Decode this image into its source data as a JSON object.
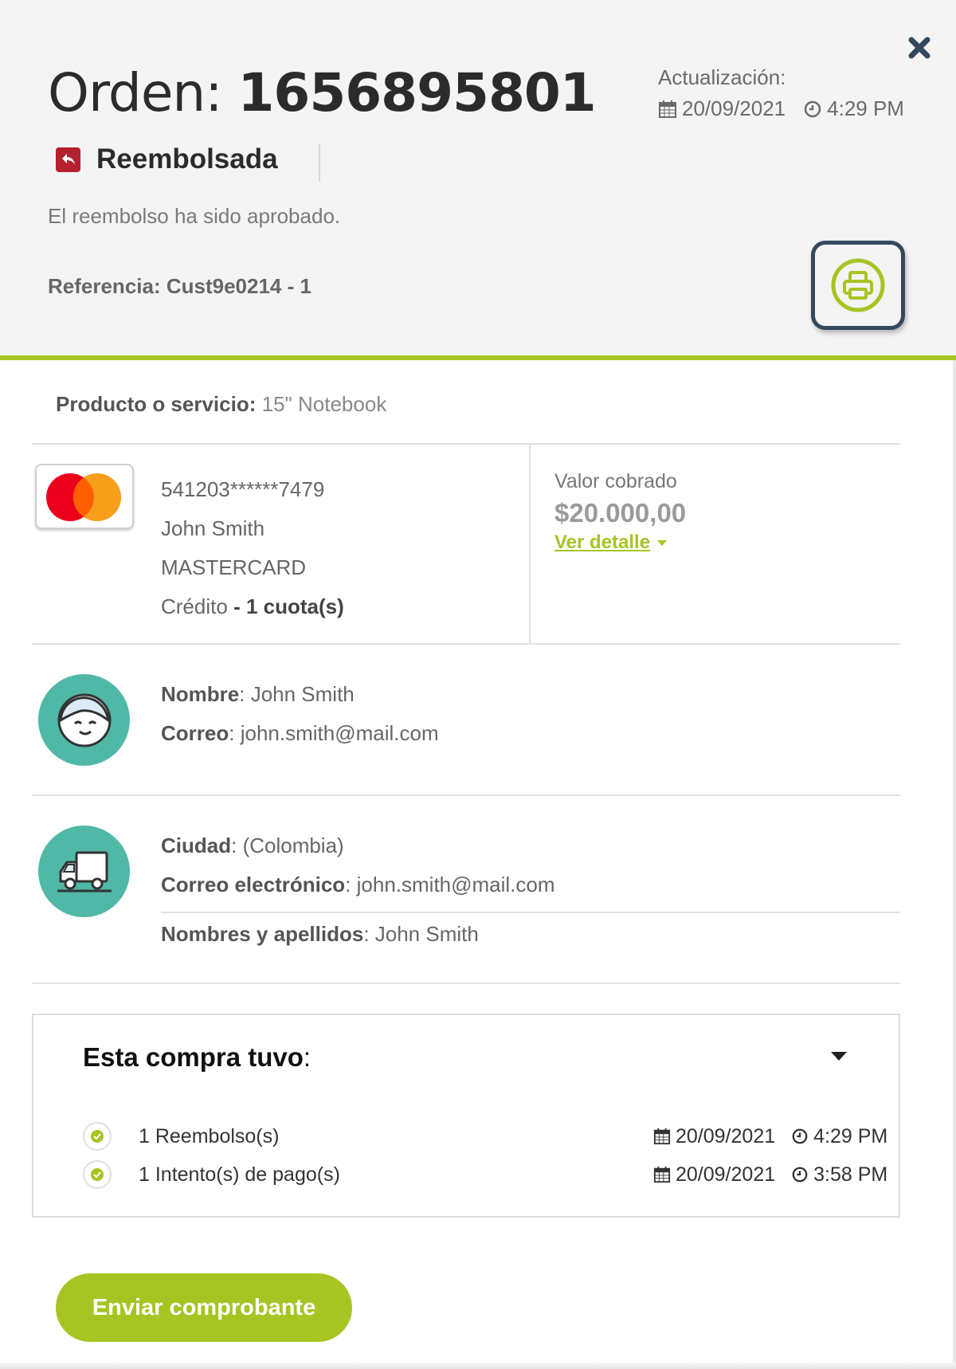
{
  "header": {
    "title_prefix": "Orden: ",
    "order_number": "1656895801",
    "update_label": "Actualización:",
    "update_date": "20/09/2021",
    "update_time": "4:29 PM",
    "status": "Reembolsada",
    "status_color": "#b5202e",
    "status_message": "El reembolso ha sido aprobado.",
    "reference": "Referencia: Cust9e0214 - 1",
    "close_icon": "close-icon",
    "print_icon": "printer-icon"
  },
  "product": {
    "label": "Producto o servicio",
    "value": "15\" Notebook"
  },
  "payment": {
    "card_brand_icon": "mastercard-logo",
    "card_number": "541203******7479",
    "holder": "John Smith",
    "brand": "MASTERCARD",
    "type": "Crédito",
    "installments": "- 1 cuota(s)",
    "charged_label": "Valor cobrado",
    "charged_amount": "$20.000,00",
    "detail_link": "Ver detalle"
  },
  "customer": {
    "icon": "customer-avatar-icon",
    "name_label": "Nombre",
    "name": "John Smith",
    "email_label": "Correo",
    "email": "john.smith@mail.com"
  },
  "shipping": {
    "icon": "delivery-truck-icon",
    "city_label": "Ciudad",
    "city": "(Colombia)",
    "email_label": "Correo electrónico",
    "email": "john.smith@mail.com",
    "fullname_label": "Nombres y apellidos",
    "fullname": "John Smith"
  },
  "history": {
    "title": "Esta compra tuvo",
    "events": [
      {
        "label": "1 Reembolso(s)",
        "date": "20/09/2021",
        "time": "4:29 PM"
      },
      {
        "label": "1 Intento(s) de pago(s)",
        "date": "20/09/2021",
        "time": "3:58 PM"
      }
    ]
  },
  "actions": {
    "send_receipt": "Enviar comprobante"
  },
  "colors": {
    "accent": "#a6c523",
    "avatar_bg": "#4fb8a6",
    "print_border": "#34495e"
  }
}
